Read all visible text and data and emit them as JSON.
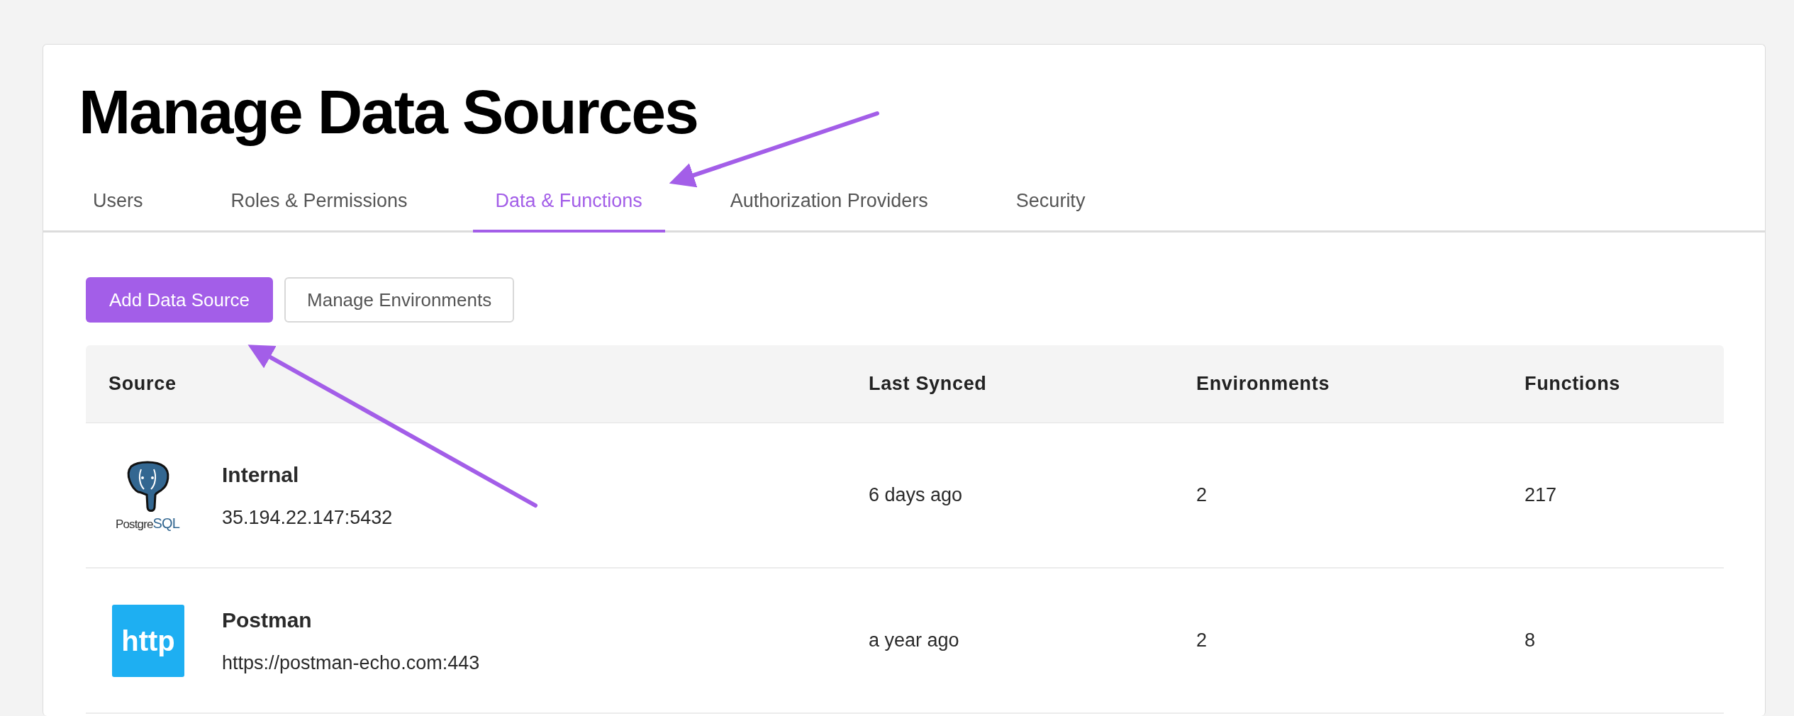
{
  "page": {
    "title": "Manage Data Sources"
  },
  "tabs": [
    {
      "label": "Users",
      "selected": false
    },
    {
      "label": "Roles & Permissions",
      "selected": false
    },
    {
      "label": "Data & Functions",
      "selected": true
    },
    {
      "label": "Authorization Providers",
      "selected": false
    },
    {
      "label": "Security",
      "selected": false
    }
  ],
  "buttons": [
    {
      "label": "Add Data Source",
      "kind": "primary"
    },
    {
      "label": "Manage Environments",
      "kind": "secondary"
    }
  ],
  "table": {
    "columns": [
      "Source",
      "Last Synced",
      "Environments",
      "Functions"
    ],
    "rows": [
      {
        "kind": "postgres",
        "logo_parts": [
          "Postgre",
          "SQL"
        ],
        "name": "Internal",
        "address": "35.194.22.147:5432",
        "last_synced": "6 days ago",
        "environments": "2",
        "functions": "217"
      },
      {
        "kind": "http",
        "logo_text": "http",
        "name": "Postman",
        "address": "https://postman-echo.com:443",
        "last_synced": "a year ago",
        "environments": "2",
        "functions": "8"
      }
    ]
  }
}
